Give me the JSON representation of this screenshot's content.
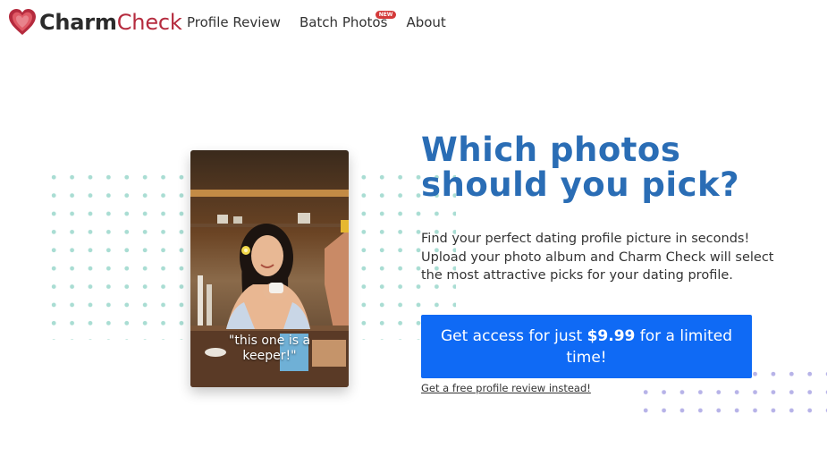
{
  "header": {
    "brand_part1": "Charm",
    "brand_part2": "Check",
    "nav": [
      {
        "label": "Profile Review"
      },
      {
        "label": "Batch Photos",
        "badge": "NEW"
      },
      {
        "label": "About"
      }
    ]
  },
  "hero": {
    "title": "Which photos should you pick?",
    "description": "Find your perfect dating profile picture in seconds! Upload your photo album and Charm Check will select the most attractive picks for your dating profile.",
    "cta_prefix": "Get access for just ",
    "cta_price": "$9.99",
    "cta_suffix": " for a limited time!",
    "free_link": "Get a free profile review instead!"
  },
  "photo": {
    "caption": "\"this one is a keeper!\""
  },
  "colors": {
    "brand_red": "#b52b3e",
    "title_blue": "#2a6db5",
    "cta_blue": "#0f6af5",
    "badge_red": "#d43a3a",
    "dots_green": "#a9ddd3",
    "dots_purple": "#b7b3e8"
  },
  "icons": {
    "logo": "heart-icon"
  }
}
